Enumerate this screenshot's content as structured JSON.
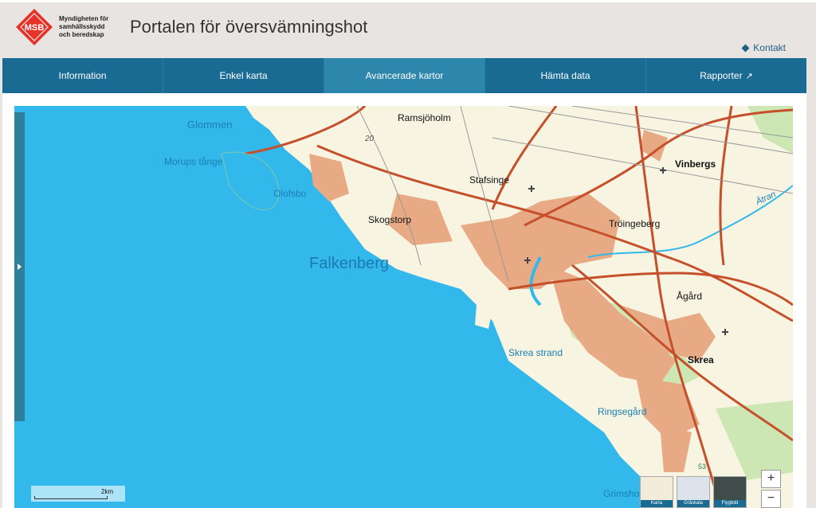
{
  "header": {
    "logo_label": "MSB",
    "org_line1": "Myndigheten för",
    "org_line2": "samhällsskydd",
    "org_line3": "och beredskap",
    "title": "Portalen för översvämningshot",
    "contact_label": "Kontakt"
  },
  "nav": {
    "items": [
      {
        "label": "Information"
      },
      {
        "label": "Enkel karta"
      },
      {
        "label": "Avancerade kartor"
      },
      {
        "label": "Hämta data"
      },
      {
        "label": "Rapporter"
      }
    ],
    "active_index": 2
  },
  "map": {
    "places": {
      "glommen": "Glommen",
      "morups_tange": "Morups tånge",
      "olofsbo": "Olofsbo",
      "ramsjoholm": "Ramsjöholm",
      "stafsinge": "Stafsinge",
      "skogstorp": "Skogstorp",
      "falkenberg": "Falkenberg",
      "vinbergs": "Vinbergs",
      "atran": "Ätran",
      "troingeberg": "Tröingeberg",
      "agard": "Ågård",
      "skrea_strand": "Skrea strand",
      "skrea": "Skrea",
      "ringsegard": "Ringsegård",
      "grimsholmen": "Grimsho",
      "road_20": "20",
      "road_53": "53"
    },
    "scale_label": "2km",
    "basemaps": [
      {
        "label": "Karta"
      },
      {
        "label": "Gråskala"
      },
      {
        "label": "Flygbild"
      }
    ],
    "zoom_in": "+",
    "zoom_out": "−",
    "colors": {
      "sea": "#33b8ec",
      "land": "#f7f4e2",
      "urban": "#e8aa84",
      "road": "#c5502b",
      "forest": "#cde7b4"
    }
  }
}
